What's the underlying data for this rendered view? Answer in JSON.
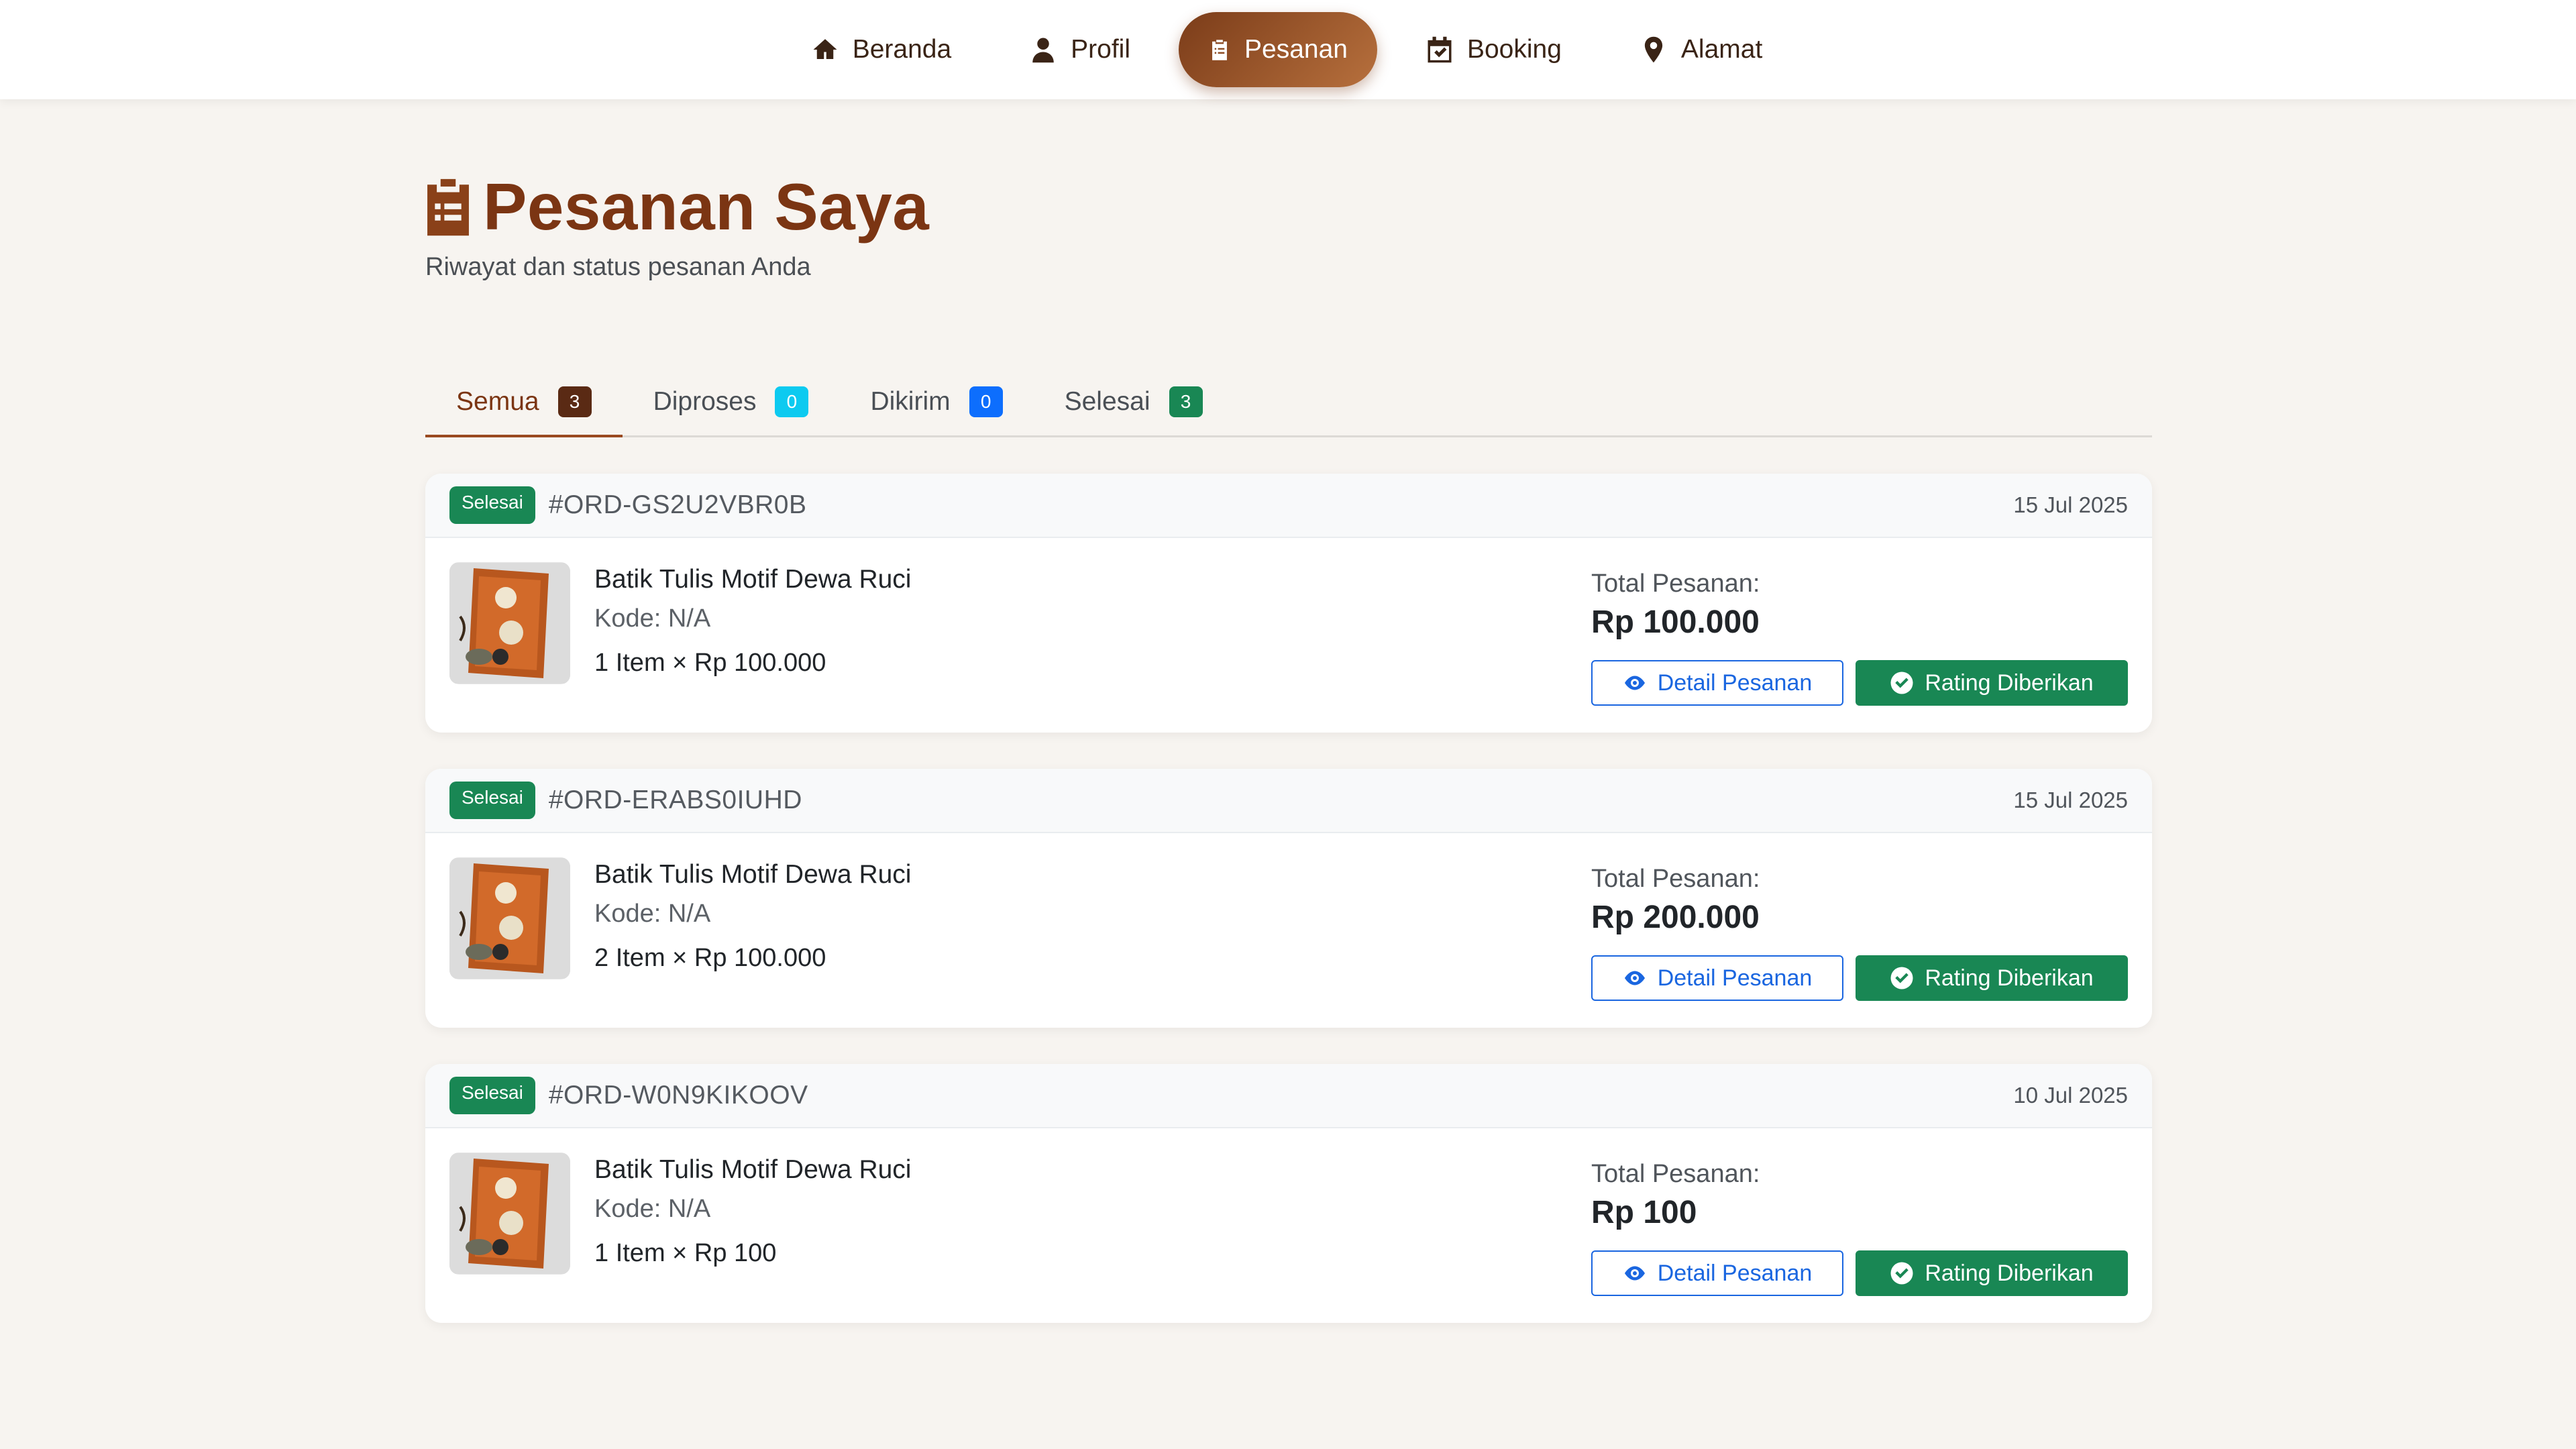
{
  "colors": {
    "brand_brown": "#7b3513",
    "nav_active_gradient_start": "#7b3c19",
    "nav_active_gradient_end": "#b7703d",
    "page_background": "#f7f4f0",
    "success_green": "#198754",
    "primary_blue": "#1a66e0",
    "info_cyan": "#0dcaf0",
    "dark_badge": "#5a2a14"
  },
  "nav": {
    "items": [
      {
        "label": "Beranda",
        "icon": "home-icon"
      },
      {
        "label": "Profil",
        "icon": "user-icon"
      },
      {
        "label": "Pesanan",
        "icon": "clipboard-list-icon",
        "active": true
      },
      {
        "label": "Booking",
        "icon": "calendar-check-icon"
      },
      {
        "label": "Alamat",
        "icon": "map-pin-icon"
      }
    ]
  },
  "header": {
    "title": "Pesanan Saya",
    "subtitle": "Riwayat dan status pesanan Anda",
    "icon": "clipboard-list-icon"
  },
  "tabs": [
    {
      "label": "Semua",
      "count": "3",
      "badge_color": "#5a2a14",
      "active": true
    },
    {
      "label": "Diproses",
      "count": "0",
      "badge_color": "#0dcaf0"
    },
    {
      "label": "Dikirim",
      "count": "0",
      "badge_color": "#0d6efd"
    },
    {
      "label": "Selesai",
      "count": "3",
      "badge_color": "#198754"
    }
  ],
  "orders": [
    {
      "status": "Selesai",
      "id": "#ORD-GS2U2VBR0B",
      "date": "15 Jul 2025",
      "product_name": "Batik Tulis Motif Dewa Ruci",
      "product_code": "Kode: N/A",
      "quantity_text": "1 Item × Rp 100.000",
      "total_label": "Total Pesanan:",
      "total_value": "Rp 100.000",
      "detail_label": "Detail Pesanan",
      "rating_label": "Rating Diberikan"
    },
    {
      "status": "Selesai",
      "id": "#ORD-ERABS0IUHD",
      "date": "15 Jul 2025",
      "product_name": "Batik Tulis Motif Dewa Ruci",
      "product_code": "Kode: N/A",
      "quantity_text": "2 Item × Rp 100.000",
      "total_label": "Total Pesanan:",
      "total_value": "Rp 200.000",
      "detail_label": "Detail Pesanan",
      "rating_label": "Rating Diberikan"
    },
    {
      "status": "Selesai",
      "id": "#ORD-W0N9KIKOOV",
      "date": "10 Jul 2025",
      "product_name": "Batik Tulis Motif Dewa Ruci",
      "product_code": "Kode: N/A",
      "quantity_text": "1 Item × Rp 100",
      "total_label": "Total Pesanan:",
      "total_value": "Rp 100",
      "detail_label": "Detail Pesanan",
      "rating_label": "Rating Diberikan"
    }
  ]
}
